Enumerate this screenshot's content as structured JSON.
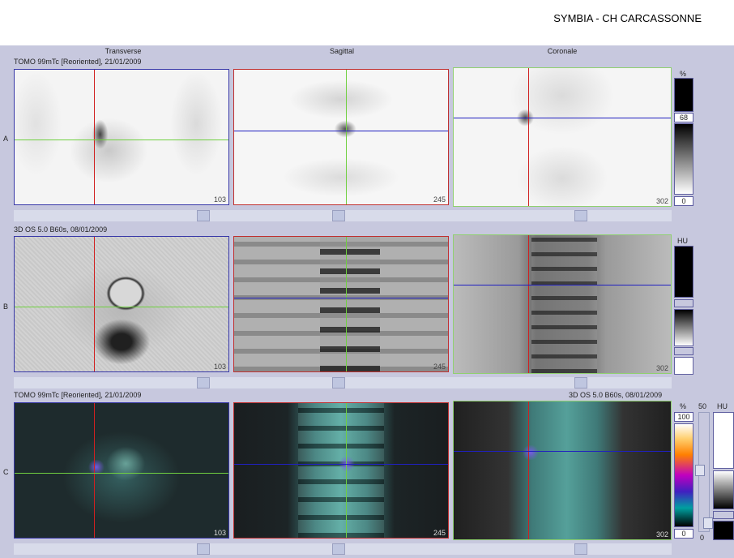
{
  "header": {
    "title": "SYMBIA - CH CARCASSONNE"
  },
  "columns": {
    "transverse": "Transverse",
    "sagittal": "Sagittal",
    "coronal": "Coronale"
  },
  "rows": {
    "a": {
      "label": "A",
      "series": "TOMO 99mTc [Reoriented], 21/01/2009"
    },
    "b": {
      "label": "B",
      "series": "3D  OS  5.0  B60s, 08/01/2009"
    },
    "c": {
      "label": "C",
      "series_left": "TOMO 99mTc [Reoriented], 21/01/2009",
      "series_right": "3D  OS  5.0  B60s, 08/01/2009"
    }
  },
  "slices": {
    "transverse": "103",
    "sagittal": "245",
    "coronal": "302"
  },
  "colorbars": {
    "a": {
      "unit": "%",
      "top": "68",
      "bottom": "0"
    },
    "b": {
      "unit": "HU"
    },
    "c": {
      "unit_left": "%",
      "top": "100",
      "bottom": "0",
      "mid": "50",
      "unit_right": "HU",
      "zero": "0"
    }
  },
  "colors": {
    "cursor_red": "#d02020",
    "cursor_green": "#70d040",
    "cursor_blue": "#2020c0",
    "background": "#c7c8de"
  }
}
